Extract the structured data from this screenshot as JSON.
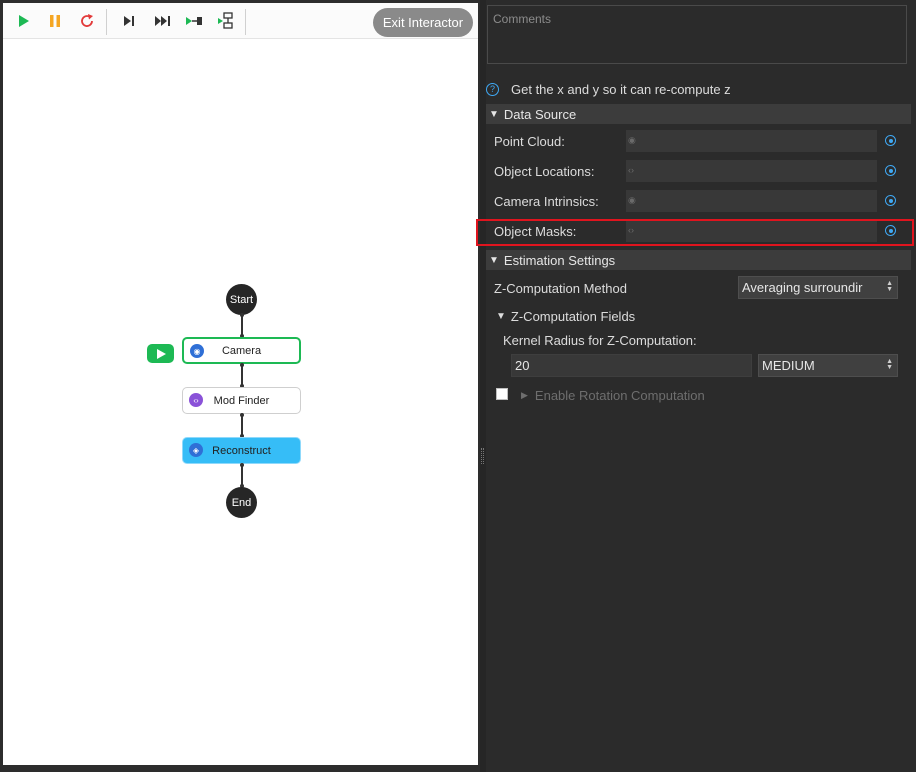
{
  "toolbar": {
    "exit_label": "Exit Interactor",
    "colors": {
      "play": "#1db954",
      "pause": "#f5a623",
      "restart": "#e23a3a"
    }
  },
  "flow": {
    "start_label": "Start",
    "end_label": "End",
    "nodes": [
      {
        "label": "Camera",
        "icon": "camera-icon",
        "state": "active"
      },
      {
        "label": "Mod Finder",
        "icon": "code-icon",
        "state": "normal"
      },
      {
        "label": "Reconstruct",
        "icon": "cube-icon",
        "state": "selected"
      }
    ]
  },
  "panel": {
    "comments_placeholder": "Comments",
    "description": "Get the x and y so it can re-compute z",
    "data_source": {
      "title": "Data Source",
      "fields": [
        {
          "label": "Point Cloud:",
          "icon": "camera-icon"
        },
        {
          "label": "Object Locations:",
          "icon": "code-icon"
        },
        {
          "label": "Camera Intrinsics:",
          "icon": "camera-icon"
        },
        {
          "label": "Object Masks:",
          "icon": "code-icon"
        }
      ]
    },
    "estimation": {
      "title": "Estimation Settings",
      "z_method_label": "Z-Computation Method",
      "z_method_value": "Averaging surroundir",
      "z_fields_title": "Z-Computation Fields",
      "kernel_label": "Kernel Radius for Z-Computation:",
      "kernel_value": "20",
      "kernel_preset": "MEDIUM",
      "rotation_label": "Enable Rotation Computation"
    }
  },
  "colors": {
    "accent": "#3fa9f5",
    "highlight": "#e0141e",
    "selected_node": "#36bdf7"
  }
}
